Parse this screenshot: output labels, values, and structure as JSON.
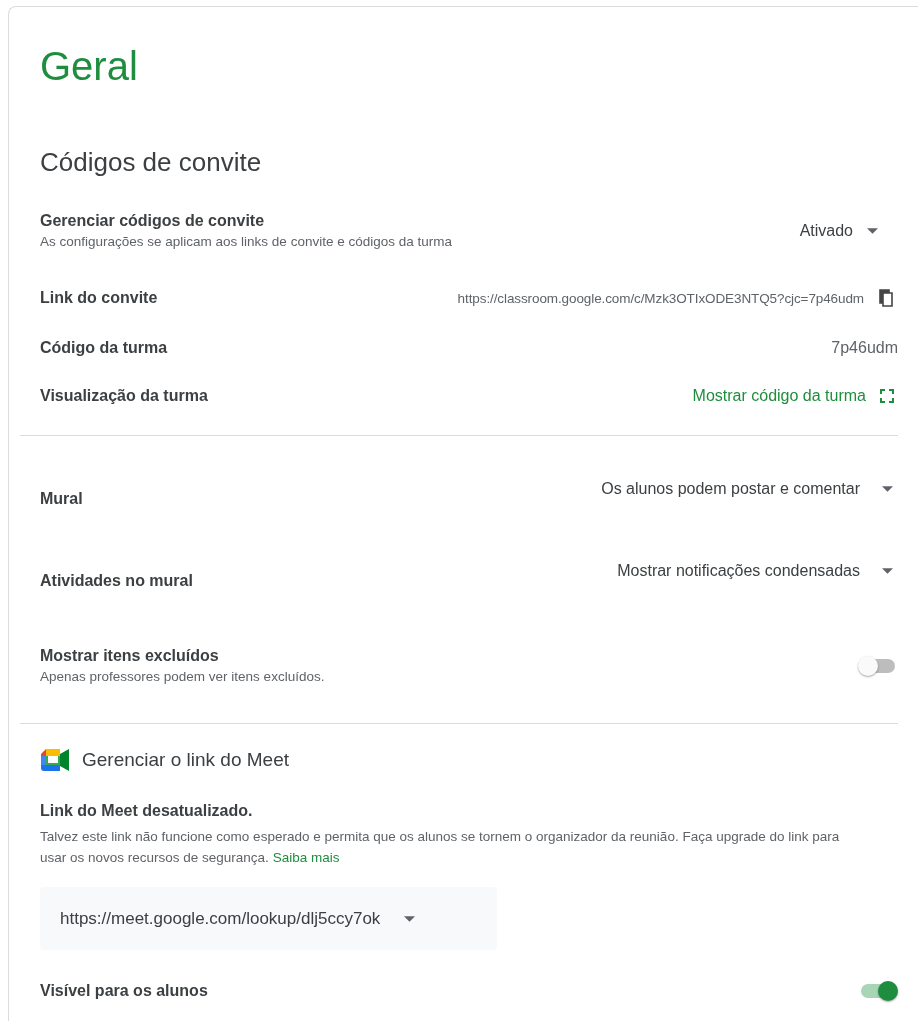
{
  "title": "Geral",
  "invite": {
    "heading": "Códigos de convite",
    "manage": {
      "label": "Gerenciar códigos de convite",
      "description": "As configurações se aplicam aos links de convite e códigos da turma",
      "value": "Ativado"
    },
    "link": {
      "label": "Link do convite",
      "value": "https://classroom.google.com/c/Mzk3OTIxODE3NTQ5?cjc=7p46udm"
    },
    "code": {
      "label": "Código da turma",
      "value": "7p46udm"
    },
    "view": {
      "label": "Visualização da turma",
      "action": "Mostrar código da turma"
    }
  },
  "stream": [
    {
      "label": "Mural",
      "value": "Os alunos podem postar e comentar"
    },
    {
      "label": "Atividades no mural",
      "value": "Mostrar notificações condensadas"
    }
  ],
  "show_deleted": {
    "label": "Mostrar itens excluídos",
    "description": "Apenas professores podem ver itens excluídos.",
    "on": false
  },
  "meet": {
    "heading": "Gerenciar o link do Meet",
    "warning_title": "Link do Meet desatualizado.",
    "warning_text": "Talvez este link não funcione como esperado e permita que os alunos se tornem o organizador da reunião. Faça upgrade do link para usar os novos recursos de segurança.",
    "learn_more": "Saiba mais",
    "link_value": "https://meet.google.com/lookup/dlj5ccy7ok",
    "visible": {
      "label": "Visível para os alunos",
      "on": true
    }
  }
}
